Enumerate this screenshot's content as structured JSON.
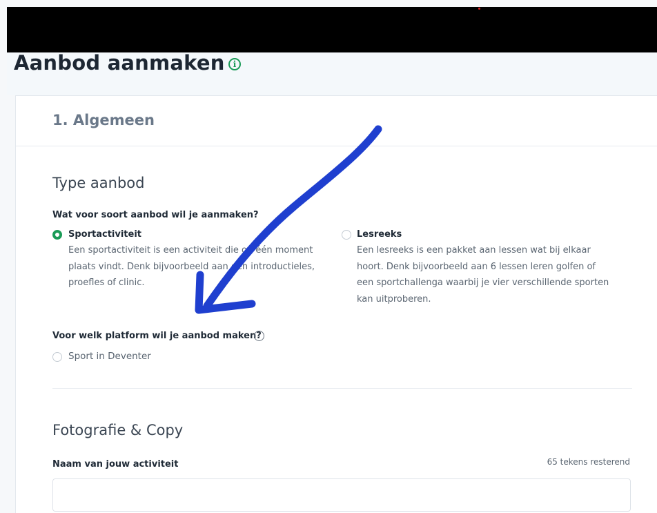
{
  "page": {
    "title": "Aanbod aanmaken",
    "title_info_icon": "info-circle-icon"
  },
  "section": {
    "step": "1. Algemeen"
  },
  "type_aanbod": {
    "heading": "Type aanbod",
    "question": "Wat voor soort aanbod wil je aanmaken?",
    "options": [
      {
        "label": "Sportactiviteit",
        "checked": true,
        "desc_lines": [
          "Een sportactiviteit is een activiteit die op één moment",
          "plaats vindt. Denk bijvoorbeeld aan een introductieles,",
          "proefles of clinic."
        ]
      },
      {
        "label": "Lesreeks",
        "checked": false,
        "desc_lines": [
          "Een lesreeks is een pakket aan lessen wat bij elkaar",
          "hoort. Denk bijvoorbeeld aan 6 lessen leren golfen of",
          "een sportchallenga waarbij je vier verschillende sporten",
          "kan uitproberen."
        ]
      }
    ]
  },
  "platform": {
    "question": "Voor welk platform wil je aanbod maken?",
    "info_icon": "info-circle-icon",
    "option_label": "Sport in Deventer",
    "checked": false
  },
  "fotografie": {
    "heading": "Fotografie & Copy",
    "name_label": "Naam van jouw activiteit",
    "chars_left": "65 tekens resterend",
    "name_value": ""
  },
  "colors": {
    "accent": "#1a9b57",
    "annotation_arrow": "#1f3fcf",
    "top_bar": "#000000"
  }
}
